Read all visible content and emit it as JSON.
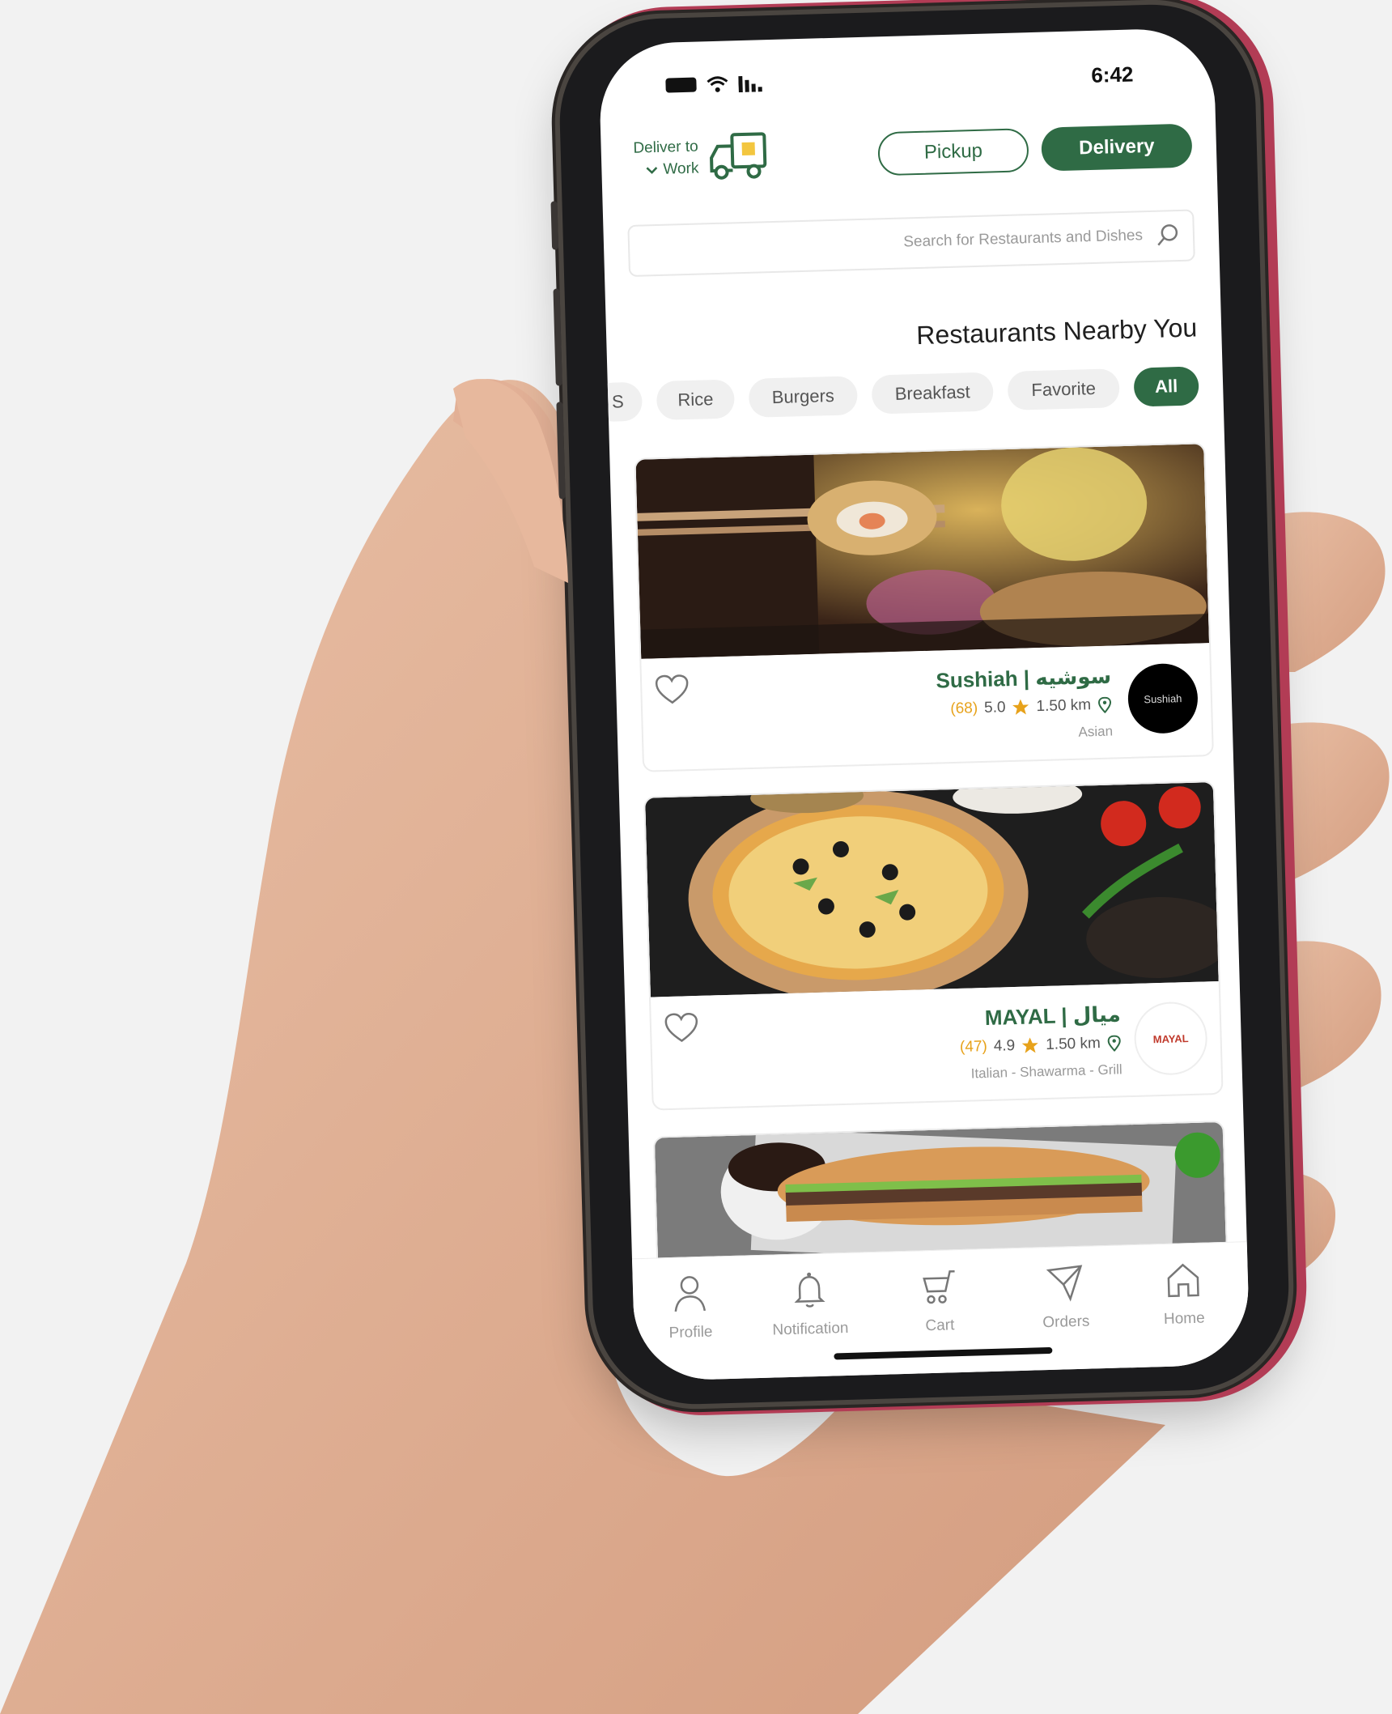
{
  "status_bar": {
    "time": "6:42"
  },
  "header": {
    "delivery_label": "Delivery",
    "pickup_label": "Pickup",
    "deliver_to_label": "Deliver to",
    "deliver_to_value": "Work"
  },
  "search": {
    "placeholder": "Search for Restaurants and Dishes"
  },
  "section_title": "Restaurants Nearby You",
  "categories": [
    "All",
    "Favorite",
    "Breakfast",
    "Burgers",
    "Rice",
    "S"
  ],
  "restaurants": [
    {
      "name": "Sushiah | سوشيه",
      "distance": "1.50 km",
      "rating": "5.0",
      "reviews": "(68)",
      "cuisine": "Asian",
      "logo_text": "Sushiah"
    },
    {
      "name": "MAYAL | ميال",
      "distance": "1.50 km",
      "rating": "4.9",
      "reviews": "(47)",
      "cuisine": "Italian - Shawarma - Grill",
      "logo_text": "MAYAL"
    }
  ],
  "tabbar": {
    "home": "Home",
    "orders": "Orders",
    "cart": "Cart",
    "notification": "Notification",
    "profile": "Profile"
  },
  "colors": {
    "brand": "#2f6b45",
    "rating": "#e7a21b",
    "phone_accent": "#b23c55"
  }
}
